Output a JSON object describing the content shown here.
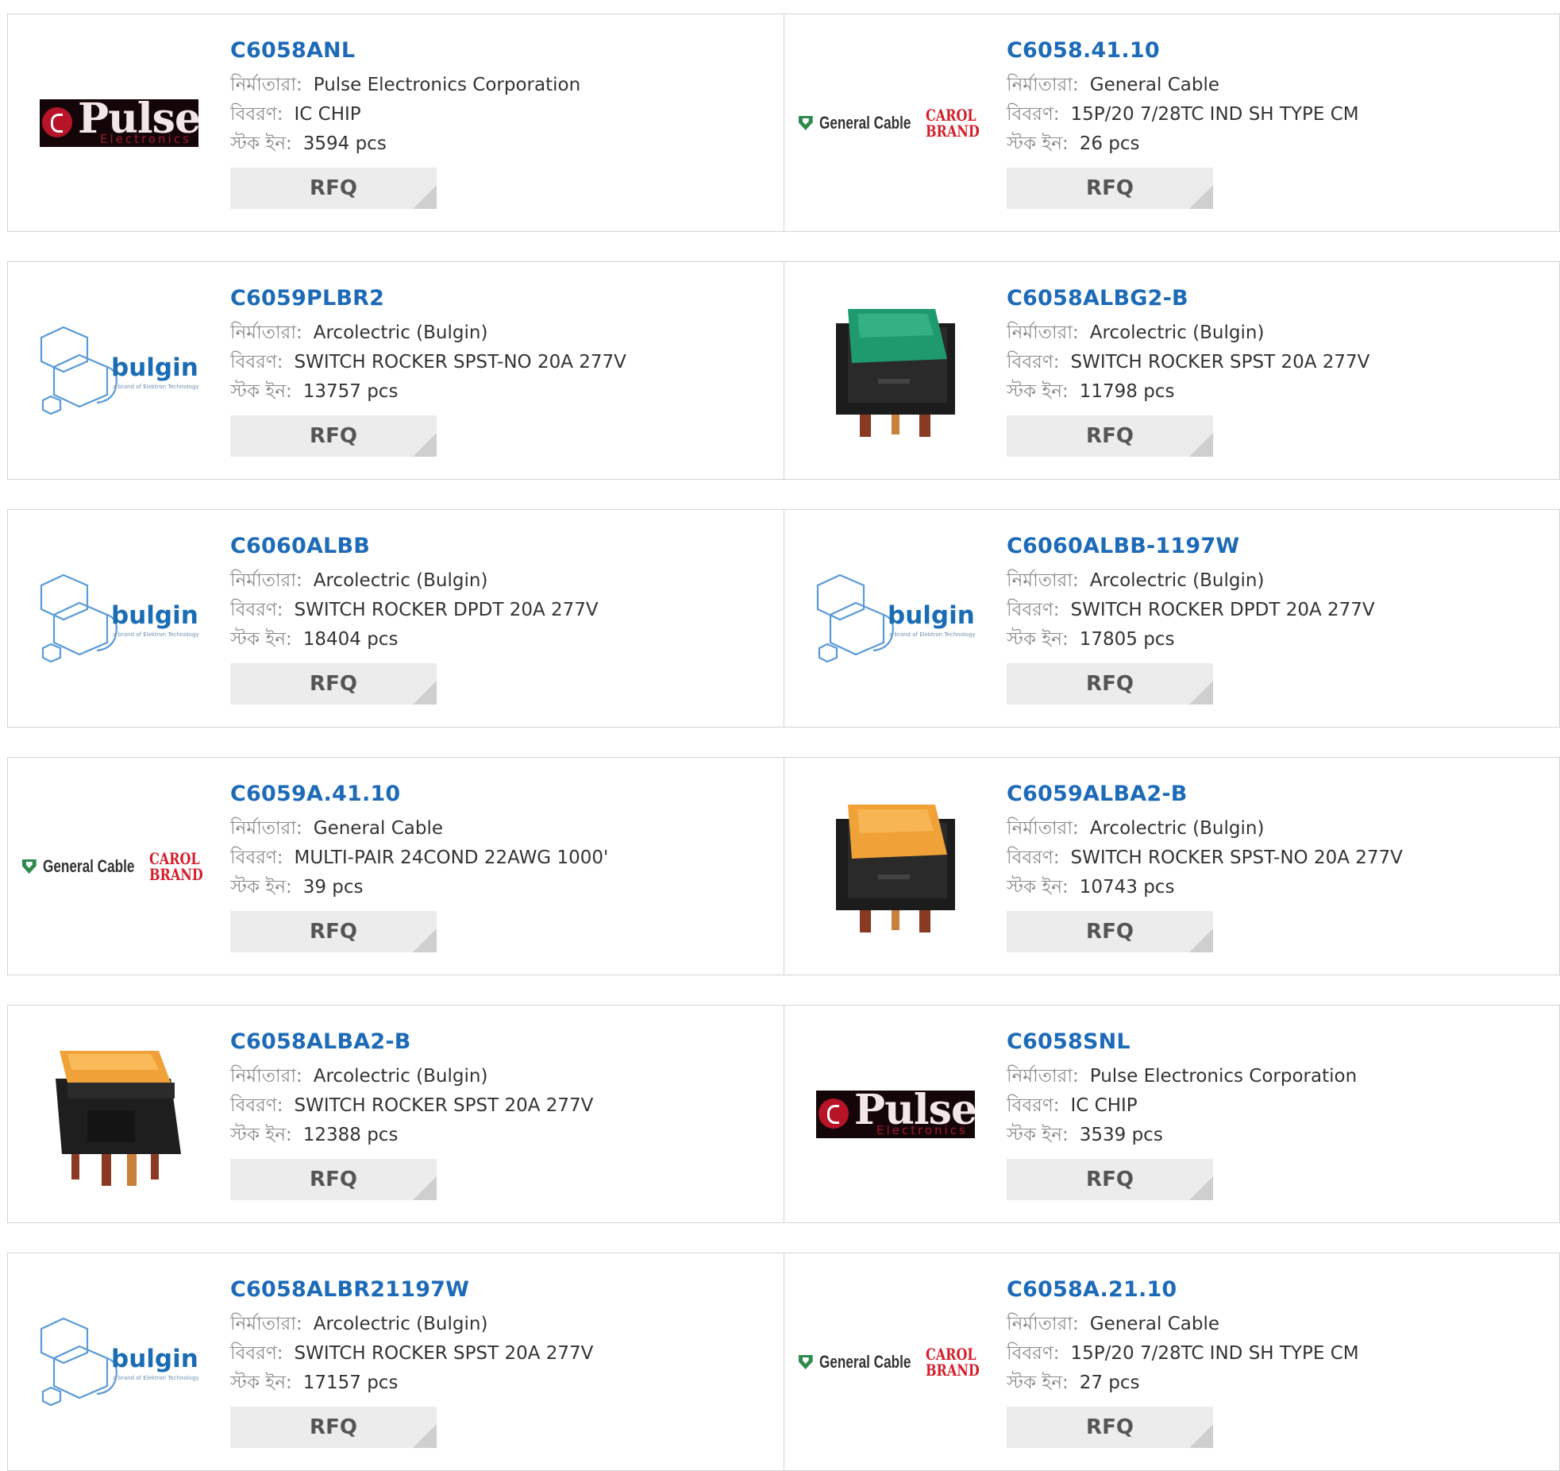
{
  "labels": {
    "manufacturer": "নির্মাতারা:",
    "description": "বিবরণ:",
    "stock": "স্টক ইন:",
    "rfq": "RFQ"
  },
  "logos": {
    "pulse": {
      "name": "Pulse",
      "sub": "Electronics"
    },
    "general_cable": {
      "name": "General Cable",
      "carol": "CAROL",
      "brand": "BRAND"
    },
    "bulgin": {
      "name": "bulgin",
      "sub": "a brand of Elektron Technology"
    }
  },
  "colors": {
    "part_link": "#1d6bb8",
    "rfq_bg": "#ececec",
    "switch_green": "#1f9a6e",
    "switch_amber": "#f0a238"
  },
  "products": [
    {
      "part": "C6058ANL",
      "manufacturer": "Pulse Electronics Corporation",
      "description": "IC CHIP",
      "stock": "3594 pcs",
      "image": "pulse-logo"
    },
    {
      "part": "C6058.41.10",
      "manufacturer": "General Cable",
      "description": "15P/20 7/28TC IND SH TYPE CM",
      "stock": "26 pcs",
      "image": "general-cable-logo"
    },
    {
      "part": "C6059PLBR2",
      "manufacturer": "Arcolectric (Bulgin)",
      "description": "SWITCH ROCKER SPST-NO 20A 277V",
      "stock": "13757 pcs",
      "image": "bulgin-logo"
    },
    {
      "part": "C6058ALBG2-B",
      "manufacturer": "Arcolectric (Bulgin)",
      "description": "SWITCH ROCKER SPST 20A 277V",
      "stock": "11798 pcs",
      "image": "green-rocker-switch"
    },
    {
      "part": "C6060ALBB",
      "manufacturer": "Arcolectric (Bulgin)",
      "description": "SWITCH ROCKER DPDT 20A 277V",
      "stock": "18404 pcs",
      "image": "bulgin-logo"
    },
    {
      "part": "C6060ALBB-1197W",
      "manufacturer": "Arcolectric (Bulgin)",
      "description": "SWITCH ROCKER DPDT 20A 277V",
      "stock": "17805 pcs",
      "image": "bulgin-logo"
    },
    {
      "part": "C6059A.41.10",
      "manufacturer": "General Cable",
      "description": "MULTI-PAIR 24COND 22AWG 1000'",
      "stock": "39 pcs",
      "image": "general-cable-logo"
    },
    {
      "part": "C6059ALBA2-B",
      "manufacturer": "Arcolectric (Bulgin)",
      "description": "SWITCH ROCKER SPST-NO 20A 277V",
      "stock": "10743 pcs",
      "image": "amber-rocker-switch"
    },
    {
      "part": "C6058ALBA2-B",
      "manufacturer": "Arcolectric (Bulgin)",
      "description": "SWITCH ROCKER SPST 20A 277V",
      "stock": "12388 pcs",
      "image": "amber-rocker-switch-large"
    },
    {
      "part": "C6058SNL",
      "manufacturer": "Pulse Electronics Corporation",
      "description": "IC CHIP",
      "stock": "3539 pcs",
      "image": "pulse-logo"
    },
    {
      "part": "C6058ALBR21197W",
      "manufacturer": "Arcolectric (Bulgin)",
      "description": "SWITCH ROCKER SPST 20A 277V",
      "stock": "17157 pcs",
      "image": "bulgin-logo"
    },
    {
      "part": "C6058A.21.10",
      "manufacturer": "General Cable",
      "description": "15P/20 7/28TC IND SH TYPE CM",
      "stock": "27 pcs",
      "image": "general-cable-logo"
    }
  ]
}
